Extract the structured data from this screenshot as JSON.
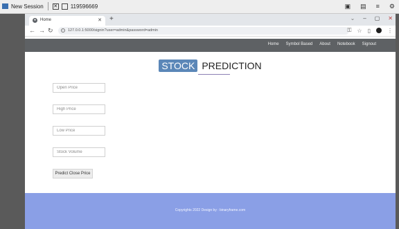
{
  "host": {
    "session_label": "New Session",
    "id_label": "119596669"
  },
  "browser": {
    "tab_title": "Home",
    "url": "127.0.0.1:5000/signin?user=admin&password=admin"
  },
  "site": {
    "nav": [
      "Home",
      "Symbol Based",
      "About",
      "Notebook",
      "Signout"
    ],
    "title_highlight": "STOCK",
    "title_rest": "PREDICTION",
    "form": {
      "open_placeholder": "Open Price",
      "high_placeholder": "High Price",
      "low_placeholder": "Low Price",
      "volume_placeholder": "Stock Volume",
      "submit_label": "Predict Close Price"
    },
    "footer_text": "Copyrights 2022 Design by : binaryframe.com"
  },
  "colors": {
    "nav_bg": "#5e6164",
    "title_badge": "#5b87b8",
    "footer_bg": "#8a9fe6"
  }
}
